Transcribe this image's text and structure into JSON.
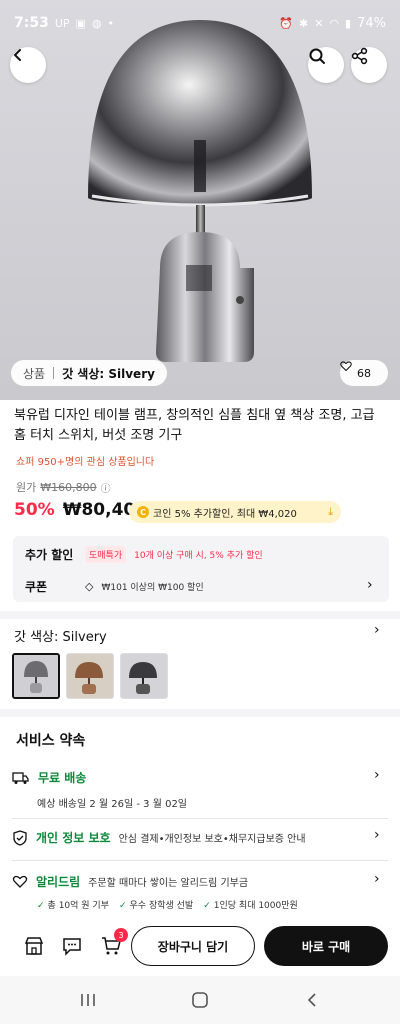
{
  "status_bar": {
    "time": "7:53",
    "battery": "74%",
    "up_label": "UP"
  },
  "hero": {
    "category": "상품",
    "option_chip": "갓 색상: Silvery",
    "likes": "68"
  },
  "product": {
    "title": "북유럽 디자인 테이블 램프, 창의적인 심플 침대 옆 책상 조명, 고급 홈 터치 스위치, 버섯 조명 기구",
    "interest": "쇼퍼 950+명의 관심 상품입니다",
    "original_label": "원가",
    "original_price": "₩160,800",
    "discount": "50%",
    "sale_price": "₩80,400",
    "coin_text": "코인 5% 추가할인, 최대 ₩4,020"
  },
  "benefits": {
    "extra_label": "추가 할인",
    "extra_tag": "도매특가",
    "extra_text": "10개 이상 구매 시, 5% 추가 할인",
    "coupon_label": "쿠폰",
    "coupon_text": "₩101 이상의 ₩100 할인"
  },
  "option": {
    "title": "갓 색상: Silvery"
  },
  "service": {
    "title": "서비스 약속",
    "shipping_name": "무료 배송",
    "shipping_sub": "예상 배송일 2 월 26일 - 3 월 02일",
    "privacy_name": "개인 정보 보호",
    "privacy_desc": "안심 결제•개인정보 보호•채무지급보증 안내",
    "aliedream_name": "알리드림",
    "aliedream_desc": "주문할 때마다 쌓이는 알리드림 기부금",
    "bullet_1": "총 10억 원 기부",
    "bullet_2": "우수 장학생 선발",
    "bullet_3": "1인당 최대 1000만원"
  },
  "action_bar": {
    "cart_count": "3",
    "add_to_cart": "장바구니 담기",
    "buy_now": "바로 구매"
  },
  "colors": {
    "accent_red": "#ff2a4a",
    "green": "#0c8a3a",
    "orange": "#e0502c"
  }
}
